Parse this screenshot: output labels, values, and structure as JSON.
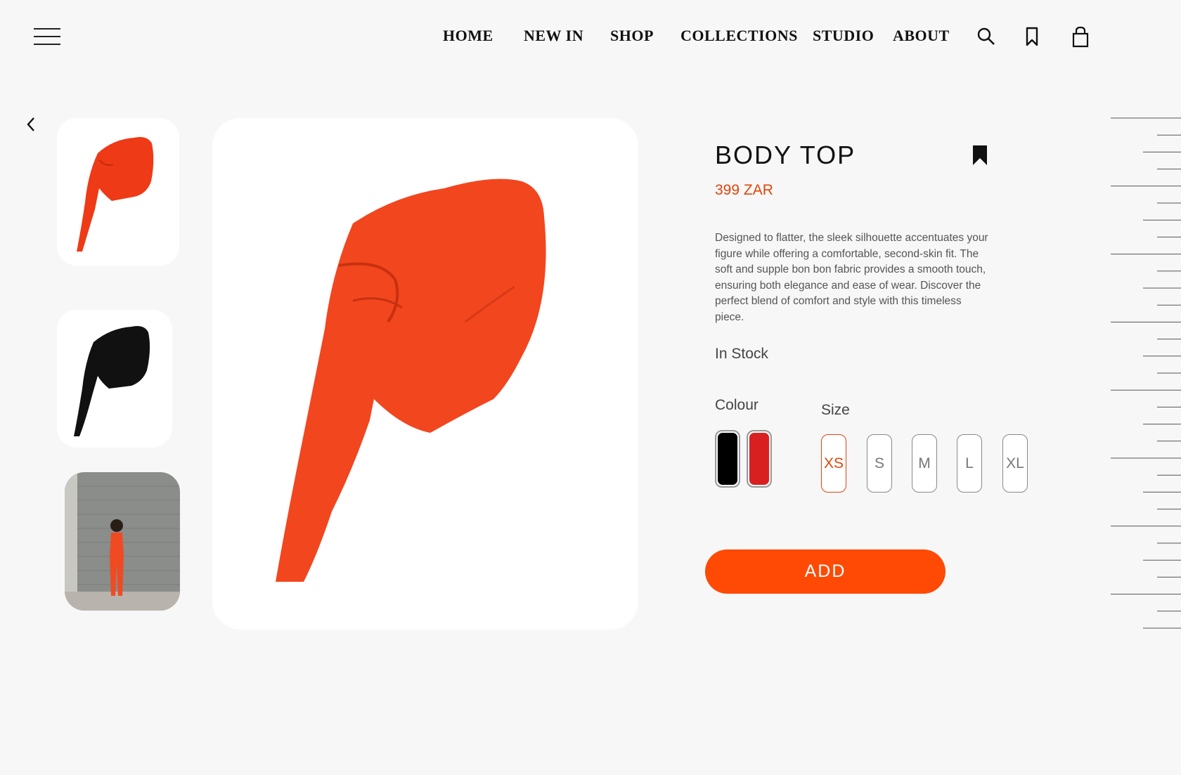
{
  "header": {
    "nav": [
      "HOME",
      "NEW IN",
      "SHOP",
      "COLLECTIONS",
      "STUDIO",
      "ABOUT"
    ]
  },
  "product": {
    "title": "BODY TOP",
    "price": "399 ZAR",
    "description": "Designed to flatter, the sleek silhouette accentuates your figure while offering a comfortable, second-skin fit. The soft and supple bon bon fabric provides a smooth touch, ensuring both elegance and ease of wear. Discover the perfect blend of comfort and style with this timeless piece.",
    "stock": "In Stock",
    "colour_label": "Colour",
    "size_label": "Size",
    "colours": [
      "#000000",
      "#d92020"
    ],
    "sizes": [
      "XS",
      "S",
      "M",
      "L",
      "XL"
    ],
    "selected_size": "XS",
    "add_label": "ADD"
  },
  "colors": {
    "accent": "#ff4a05",
    "price": "#e0440a",
    "background": "#f7f7f7"
  }
}
